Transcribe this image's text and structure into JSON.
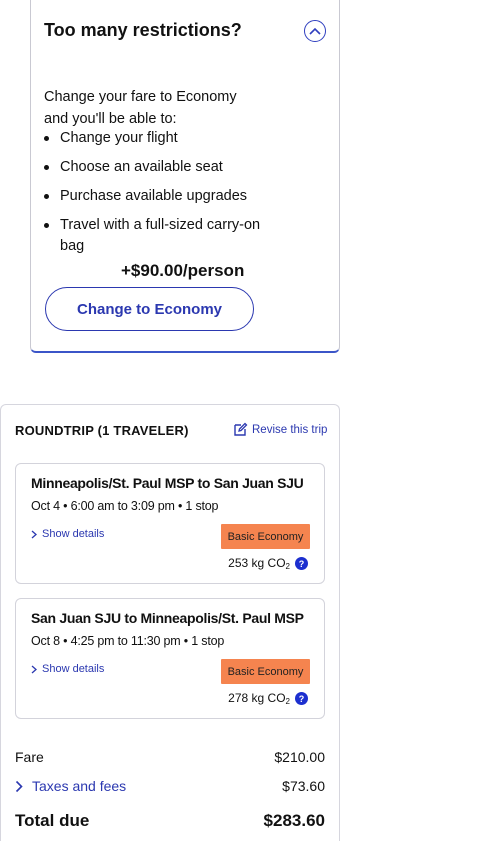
{
  "upsell": {
    "title": "Too many restrictions?",
    "intro": "Change your fare to Economy and you'll be able to:",
    "benefits": [
      "Change your flight",
      "Choose an available seat",
      "Purchase available upgrades",
      "Travel with a full-sized carry-on bag"
    ],
    "price": "+$90.00/person",
    "button_label": "Change to Economy",
    "collapse_icon": "chevron-up-circle-icon"
  },
  "summary": {
    "heading": "ROUNDTRIP (1 TRAVELER)",
    "revise_label": "Revise this trip",
    "revise_icon": "edit-icon",
    "flights": [
      {
        "route": "Minneapolis/St. Paul MSP to San Juan SJU",
        "times": "Oct 4 • 6:00 am to 3:09 pm • 1 stop",
        "details_label": "Show details",
        "fare_class": "Basic Economy",
        "emissions": "253 kg CO",
        "emissions_sub": "2"
      },
      {
        "route": "San Juan SJU to Minneapolis/St. Paul MSP",
        "times": "Oct 8 • 4:25 pm to 11:30 pm • 1 stop",
        "details_label": "Show details",
        "fare_class": "Basic Economy",
        "emissions": "278 kg CO",
        "emissions_sub": "2"
      }
    ],
    "costs": {
      "fare_label": "Fare",
      "fare_value": "$210.00",
      "taxes_label": "Taxes and fees",
      "taxes_value": "$73.60",
      "total_label": "Total due",
      "total_value": "$283.60"
    }
  },
  "colors": {
    "link_blue": "#2b38b0",
    "badge_orange": "#f5844f",
    "help_blue": "#1c2fcf"
  }
}
